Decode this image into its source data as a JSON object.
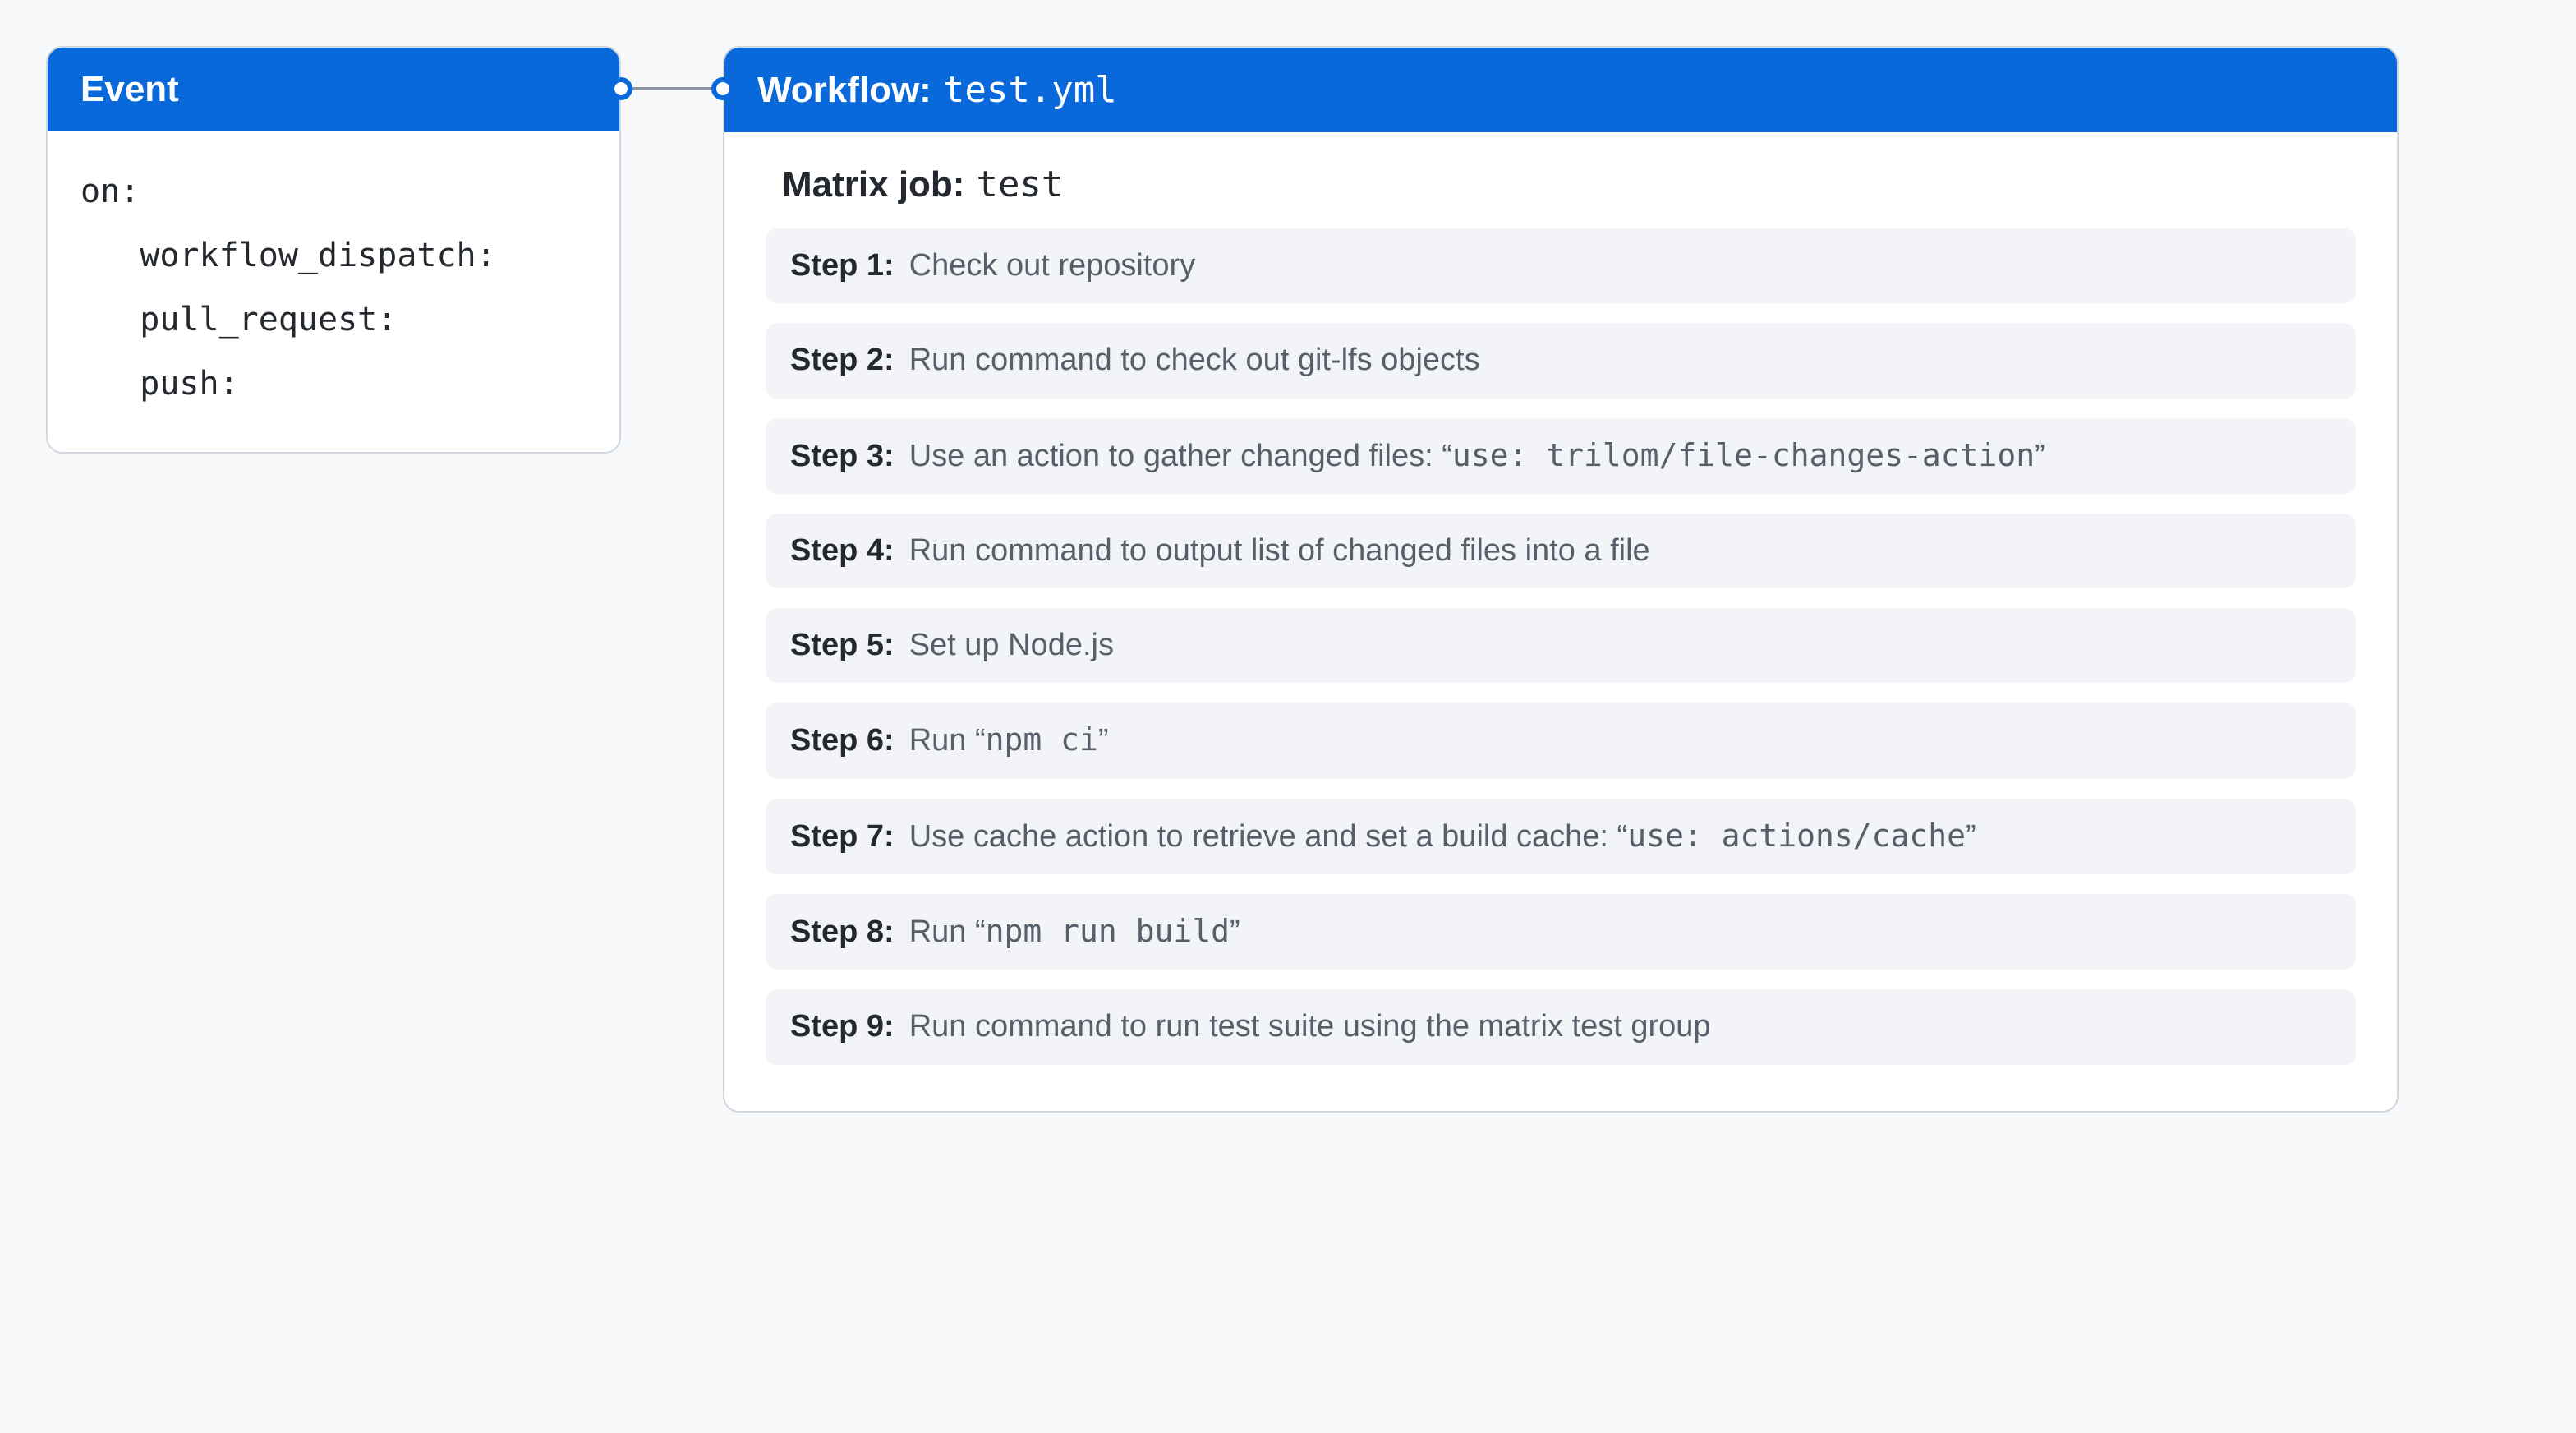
{
  "event": {
    "header": "Event",
    "code_lines": [
      "on:",
      "   workflow_dispatch:",
      "   pull_request:",
      "   push:"
    ]
  },
  "workflow": {
    "header_label": "Workflow:",
    "header_file": "test.yml",
    "matrix_label": "Matrix job:",
    "matrix_name": "test",
    "steps": [
      {
        "label": "Step 1:",
        "text": "Check out repository"
      },
      {
        "label": "Step 2:",
        "text": "Run command to check out git-lfs objects"
      },
      {
        "label": "Step 3:",
        "text_pre": "Use an action to gather changed files: “",
        "code": "use: trilom/file-changes-action",
        "text_post": "”"
      },
      {
        "label": "Step 4:",
        "text": "Run command to output list of changed files into a file"
      },
      {
        "label": "Step 5:",
        "text": "Set up Node.js"
      },
      {
        "label": "Step 6:",
        "text_pre": "Run “",
        "code": "npm ci",
        "text_post": "”"
      },
      {
        "label": "Step 7:",
        "text_pre": "Use cache action to retrieve and set a build cache: “",
        "code": "use: actions/cache",
        "text_post": "”"
      },
      {
        "label": "Step 8:",
        "text_pre": "Run “",
        "code": "npm run build",
        "text_post": "”"
      },
      {
        "label": "Step 9:",
        "text": "Run command to run test suite using the matrix test group"
      }
    ]
  }
}
